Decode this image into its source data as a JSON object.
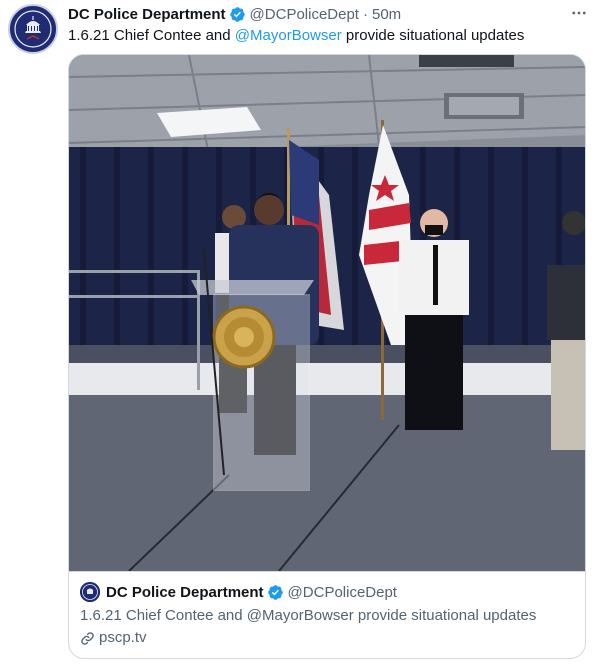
{
  "tweet": {
    "author": {
      "display_name": "DC Police Department",
      "handle": "@DCPoliceDept",
      "verified": true,
      "avatar_icon": "police-badge-icon"
    },
    "separator": "·",
    "timestamp": "50m",
    "more_icon": "more-horizontal-icon",
    "text_prefix": "1.6.21 Chief Contee and ",
    "mention": "@MayorBowser",
    "text_suffix": " provide situational updates"
  },
  "card": {
    "author_name": "DC Police Department",
    "author_handle": "@DCPoliceDept",
    "text": "1.6.21 Chief Contee and @MayorBowser provide situational updates",
    "link_domain": "pscp.tv",
    "link_icon": "link-icon"
  },
  "colors": {
    "link": "#1d9bf0",
    "verified": "#1d9bf0",
    "secondary_text": "#536471",
    "border": "#cfd9de",
    "avatar_bg": "#1f2b73"
  }
}
